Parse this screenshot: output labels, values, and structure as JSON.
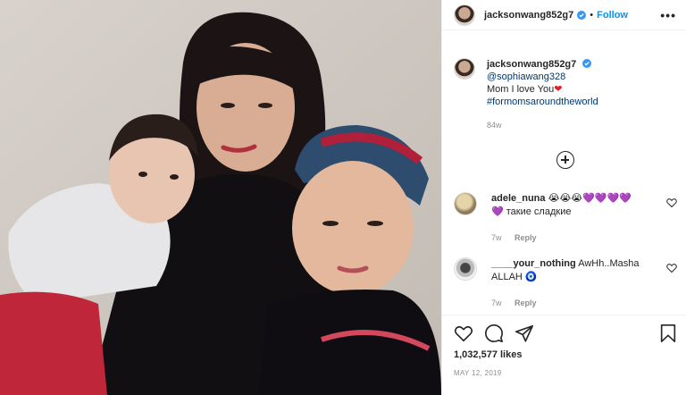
{
  "post": {
    "username": "jacksonwang852g7",
    "follow_label": "Follow",
    "dot": "•",
    "more": "•••"
  },
  "caption": {
    "username": "jacksonwang852g7",
    "mention": "@sophiawang328",
    "text": "Mom I love You",
    "emoji": "❤",
    "hashtag": "#formomsaroundtheworld",
    "age": "84w"
  },
  "comments": [
    {
      "username": "adele_nuna",
      "emoji_line": "😭😭😭💜💜💜💜",
      "emoji_prefix": "💜",
      "text": "такие сладкие",
      "age": "7w",
      "reply": "Reply"
    },
    {
      "username": "____your_nothing",
      "text": "AwHh..Masha ALLAH",
      "emoji": "🧿",
      "age": "7w",
      "reply": "Reply"
    }
  ],
  "likes": "1,032,577 likes",
  "date": "MAY 12, 2019",
  "colors": {
    "link": "#00376b",
    "follow": "#0095f6",
    "verified": "#3897f0"
  },
  "icons": [
    "verified-icon",
    "more-icon",
    "add-comments-icon",
    "heart-icon",
    "comment-icon",
    "share-icon",
    "save-icon"
  ]
}
